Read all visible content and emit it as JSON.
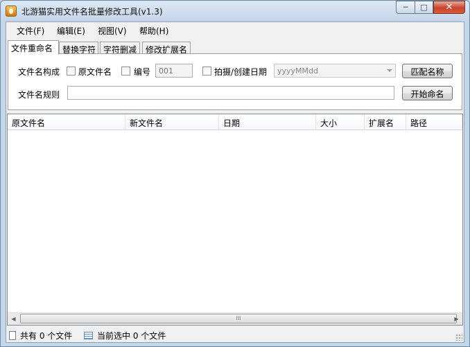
{
  "window": {
    "title": "北游猫实用文件名批量修改工具(v1.3)"
  },
  "menu": [
    "文件(F)",
    "编辑(E)",
    "视图(V)",
    "帮助(H)"
  ],
  "tabs": [
    "文件重命名",
    "替换字符",
    "字符删减",
    "修改扩展名"
  ],
  "rename": {
    "composition_label": "文件名构成",
    "original_name_label": "原文件名",
    "number_label": "编号",
    "number_value": "001",
    "date_label": "拍摄/创建日期",
    "date_format": "yyyyMMdd",
    "match_button": "匹配名称",
    "rule_label": "文件名规则",
    "rule_value": "",
    "start_button": "开始命名"
  },
  "table": {
    "columns": [
      "原文件名",
      "新文件名",
      "日期",
      "大小",
      "扩展名",
      "路径"
    ],
    "rows": []
  },
  "scrollbar": {
    "thumb_label": "III"
  },
  "status": {
    "total": "共有 0 个文件",
    "selected": "当前选中 0 个文件"
  }
}
